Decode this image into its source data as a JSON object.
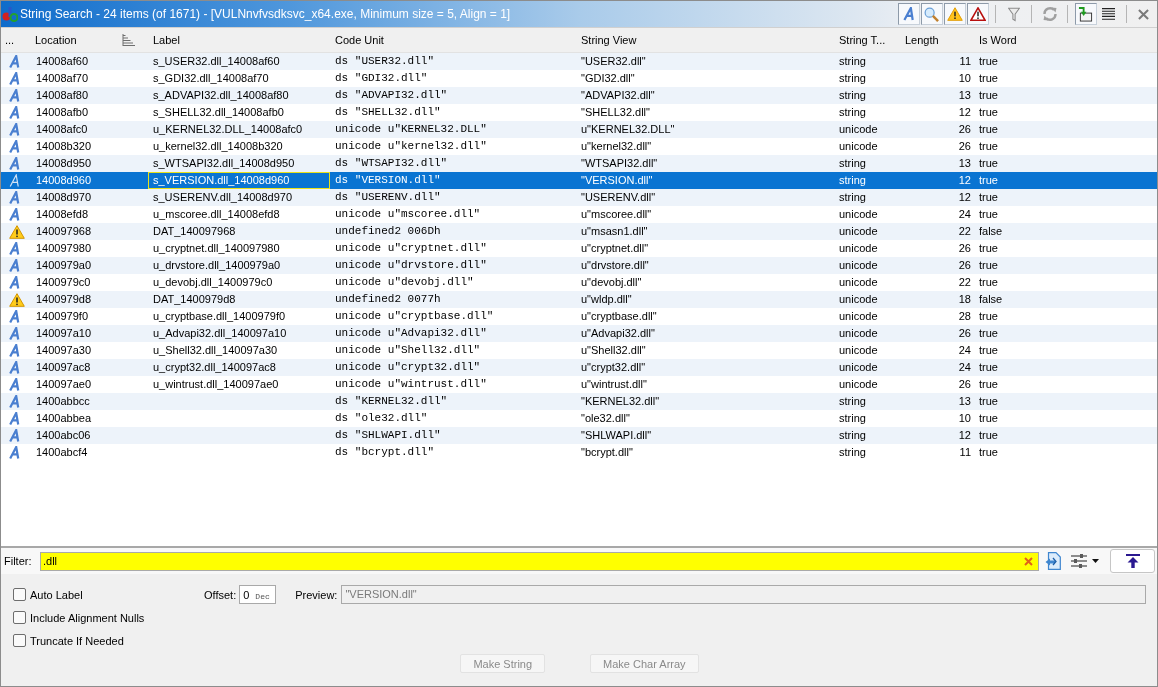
{
  "window": {
    "title": "String Search - 24 items (of 1671) - [VULNnvfvsdksvc_x64.exe, Minimum size = 5, Align = 1]"
  },
  "toolbar": {
    "left_toggles": [
      {
        "on": true
      },
      {
        "on": true
      },
      {
        "on": true
      },
      {
        "on": true
      }
    ],
    "right_toggles": [
      {
        "on": true
      }
    ]
  },
  "table": {
    "columns": [
      {
        "label": "...",
        "focused": false
      },
      {
        "label": "Location",
        "focused": false
      },
      {
        "label": "Label",
        "focused": true
      },
      {
        "label": "Code Unit",
        "focused": false
      },
      {
        "label": "String View",
        "focused": false
      },
      {
        "label": "String T...",
        "focused": false
      },
      {
        "label": "Length",
        "focused": false
      },
      {
        "label": "Is Word",
        "focused": false
      }
    ],
    "rows": [
      {
        "kind": "defined",
        "selected": false,
        "location": "14008af60",
        "label": "s_USER32.dll_14008af60",
        "code_unit": "ds \"USER32.dll\"",
        "string_view": "\"USER32.dll\"",
        "string_type": "string",
        "length": "11",
        "is_word": "true"
      },
      {
        "kind": "defined",
        "selected": false,
        "location": "14008af70",
        "label": "s_GDI32.dll_14008af70",
        "code_unit": "ds \"GDI32.dll\"",
        "string_view": "\"GDI32.dll\"",
        "string_type": "string",
        "length": "10",
        "is_word": "true"
      },
      {
        "kind": "defined",
        "selected": false,
        "location": "14008af80",
        "label": "s_ADVAPI32.dll_14008af80",
        "code_unit": "ds \"ADVAPI32.dll\"",
        "string_view": "\"ADVAPI32.dll\"",
        "string_type": "string",
        "length": "13",
        "is_word": "true"
      },
      {
        "kind": "defined",
        "selected": false,
        "location": "14008afb0",
        "label": "s_SHELL32.dll_14008afb0",
        "code_unit": "ds \"SHELL32.dll\"",
        "string_view": "\"SHELL32.dll\"",
        "string_type": "string",
        "length": "12",
        "is_word": "true"
      },
      {
        "kind": "defined",
        "selected": false,
        "location": "14008afc0",
        "label": "u_KERNEL32.DLL_14008afc0",
        "code_unit": "unicode u\"KERNEL32.DLL\"",
        "string_view": "u\"KERNEL32.DLL\"",
        "string_type": "unicode",
        "length": "26",
        "is_word": "true"
      },
      {
        "kind": "defined",
        "selected": false,
        "location": "14008b320",
        "label": "u_kernel32.dll_14008b320",
        "code_unit": "unicode u\"kernel32.dll\"",
        "string_view": "u\"kernel32.dll\"",
        "string_type": "unicode",
        "length": "26",
        "is_word": "true"
      },
      {
        "kind": "defined",
        "selected": false,
        "location": "14008d950",
        "label": "s_WTSAPI32.dll_14008d950",
        "code_unit": "ds \"WTSAPI32.dll\"",
        "string_view": "\"WTSAPI32.dll\"",
        "string_type": "string",
        "length": "13",
        "is_word": "true"
      },
      {
        "kind": "defined",
        "selected": true,
        "location": "14008d960",
        "label": "s_VERSION.dll_14008d960",
        "code_unit": "ds \"VERSION.dll\"",
        "string_view": "\"VERSION.dll\"",
        "string_type": "string",
        "length": "12",
        "is_word": "true"
      },
      {
        "kind": "defined",
        "selected": false,
        "location": "14008d970",
        "label": "s_USERENV.dll_14008d970",
        "code_unit": "ds \"USERENV.dll\"",
        "string_view": "\"USERENV.dll\"",
        "string_type": "string",
        "length": "12",
        "is_word": "true"
      },
      {
        "kind": "defined",
        "selected": false,
        "location": "14008efd8",
        "label": "u_mscoree.dll_14008efd8",
        "code_unit": "unicode u\"mscoree.dll\"",
        "string_view": "u\"mscoree.dll\"",
        "string_type": "unicode",
        "length": "24",
        "is_word": "true"
      },
      {
        "kind": "undefined",
        "selected": false,
        "location": "140097968",
        "label": "DAT_140097968",
        "code_unit": "undefined2 006Dh",
        "string_view": "u\"msasn1.dll\"",
        "string_type": "unicode",
        "length": "22",
        "is_word": "false"
      },
      {
        "kind": "defined",
        "selected": false,
        "location": "140097980",
        "label": "u_cryptnet.dll_140097980",
        "code_unit": "unicode u\"cryptnet.dll\"",
        "string_view": "u\"cryptnet.dll\"",
        "string_type": "unicode",
        "length": "26",
        "is_word": "true"
      },
      {
        "kind": "defined",
        "selected": false,
        "location": "1400979a0",
        "label": "u_drvstore.dll_1400979a0",
        "code_unit": "unicode u\"drvstore.dll\"",
        "string_view": "u\"drvstore.dll\"",
        "string_type": "unicode",
        "length": "26",
        "is_word": "true"
      },
      {
        "kind": "defined",
        "selected": false,
        "location": "1400979c0",
        "label": "u_devobj.dll_1400979c0",
        "code_unit": "unicode u\"devobj.dll\"",
        "string_view": "u\"devobj.dll\"",
        "string_type": "unicode",
        "length": "22",
        "is_word": "true"
      },
      {
        "kind": "undefined",
        "selected": false,
        "location": "1400979d8",
        "label": "DAT_1400979d8",
        "code_unit": "undefined2 0077h",
        "string_view": "u\"wldp.dll\"",
        "string_type": "unicode",
        "length": "18",
        "is_word": "false"
      },
      {
        "kind": "defined",
        "selected": false,
        "location": "1400979f0",
        "label": "u_cryptbase.dll_1400979f0",
        "code_unit": "unicode u\"cryptbase.dll\"",
        "string_view": "u\"cryptbase.dll\"",
        "string_type": "unicode",
        "length": "28",
        "is_word": "true"
      },
      {
        "kind": "defined",
        "selected": false,
        "location": "140097a10",
        "label": "u_Advapi32.dll_140097a10",
        "code_unit": "unicode u\"Advapi32.dll\"",
        "string_view": "u\"Advapi32.dll\"",
        "string_type": "unicode",
        "length": "26",
        "is_word": "true"
      },
      {
        "kind": "defined",
        "selected": false,
        "location": "140097a30",
        "label": "u_Shell32.dll_140097a30",
        "code_unit": "unicode u\"Shell32.dll\"",
        "string_view": "u\"Shell32.dll\"",
        "string_type": "unicode",
        "length": "24",
        "is_word": "true"
      },
      {
        "kind": "defined",
        "selected": false,
        "location": "140097ac8",
        "label": "u_crypt32.dll_140097ac8",
        "code_unit": "unicode u\"crypt32.dll\"",
        "string_view": "u\"crypt32.dll\"",
        "string_type": "unicode",
        "length": "24",
        "is_word": "true"
      },
      {
        "kind": "defined",
        "selected": false,
        "location": "140097ae0",
        "label": "u_wintrust.dll_140097ae0",
        "code_unit": "unicode u\"wintrust.dll\"",
        "string_view": "u\"wintrust.dll\"",
        "string_type": "unicode",
        "length": "26",
        "is_word": "true"
      },
      {
        "kind": "defined",
        "selected": false,
        "location": "1400abbcc",
        "code_unit": "ds \"KERNEL32.dll\"",
        "string_view": "\"KERNEL32.dll\"",
        "string_type": "string",
        "length": "13",
        "is_word": "true"
      },
      {
        "kind": "defined",
        "selected": false,
        "location": "1400abbea",
        "code_unit": "ds \"ole32.dll\"",
        "string_view": "\"ole32.dll\"",
        "string_type": "string",
        "length": "10",
        "is_word": "true"
      },
      {
        "kind": "defined",
        "selected": false,
        "location": "1400abc06",
        "code_unit": "ds \"SHLWAPI.dll\"",
        "string_view": "\"SHLWAPI.dll\"",
        "string_type": "string",
        "length": "12",
        "is_word": "true"
      },
      {
        "kind": "defined",
        "selected": false,
        "location": "1400abcf4",
        "code_unit": "ds \"bcrypt.dll\"",
        "string_view": "\"bcrypt.dll\"",
        "string_type": "string",
        "length": "11",
        "is_word": "true"
      }
    ]
  },
  "filter": {
    "label": "Filter:",
    "value": ".dll"
  },
  "options": {
    "checkboxes": [
      {
        "label": "Auto Label",
        "checked": false
      },
      {
        "label": "Include Alignment Nulls",
        "checked": false
      },
      {
        "label": "Truncate If Needed",
        "checked": false
      }
    ],
    "offset": {
      "label": "Offset:",
      "value": "0",
      "unit": "Dec"
    },
    "preview": {
      "label": "Preview:",
      "value": "\"VERSION.dll\"",
      "disabled": true
    },
    "buttons": [
      {
        "label": "Make String",
        "disabled": true
      },
      {
        "label": "Make Char Array",
        "disabled": true
      }
    ]
  }
}
